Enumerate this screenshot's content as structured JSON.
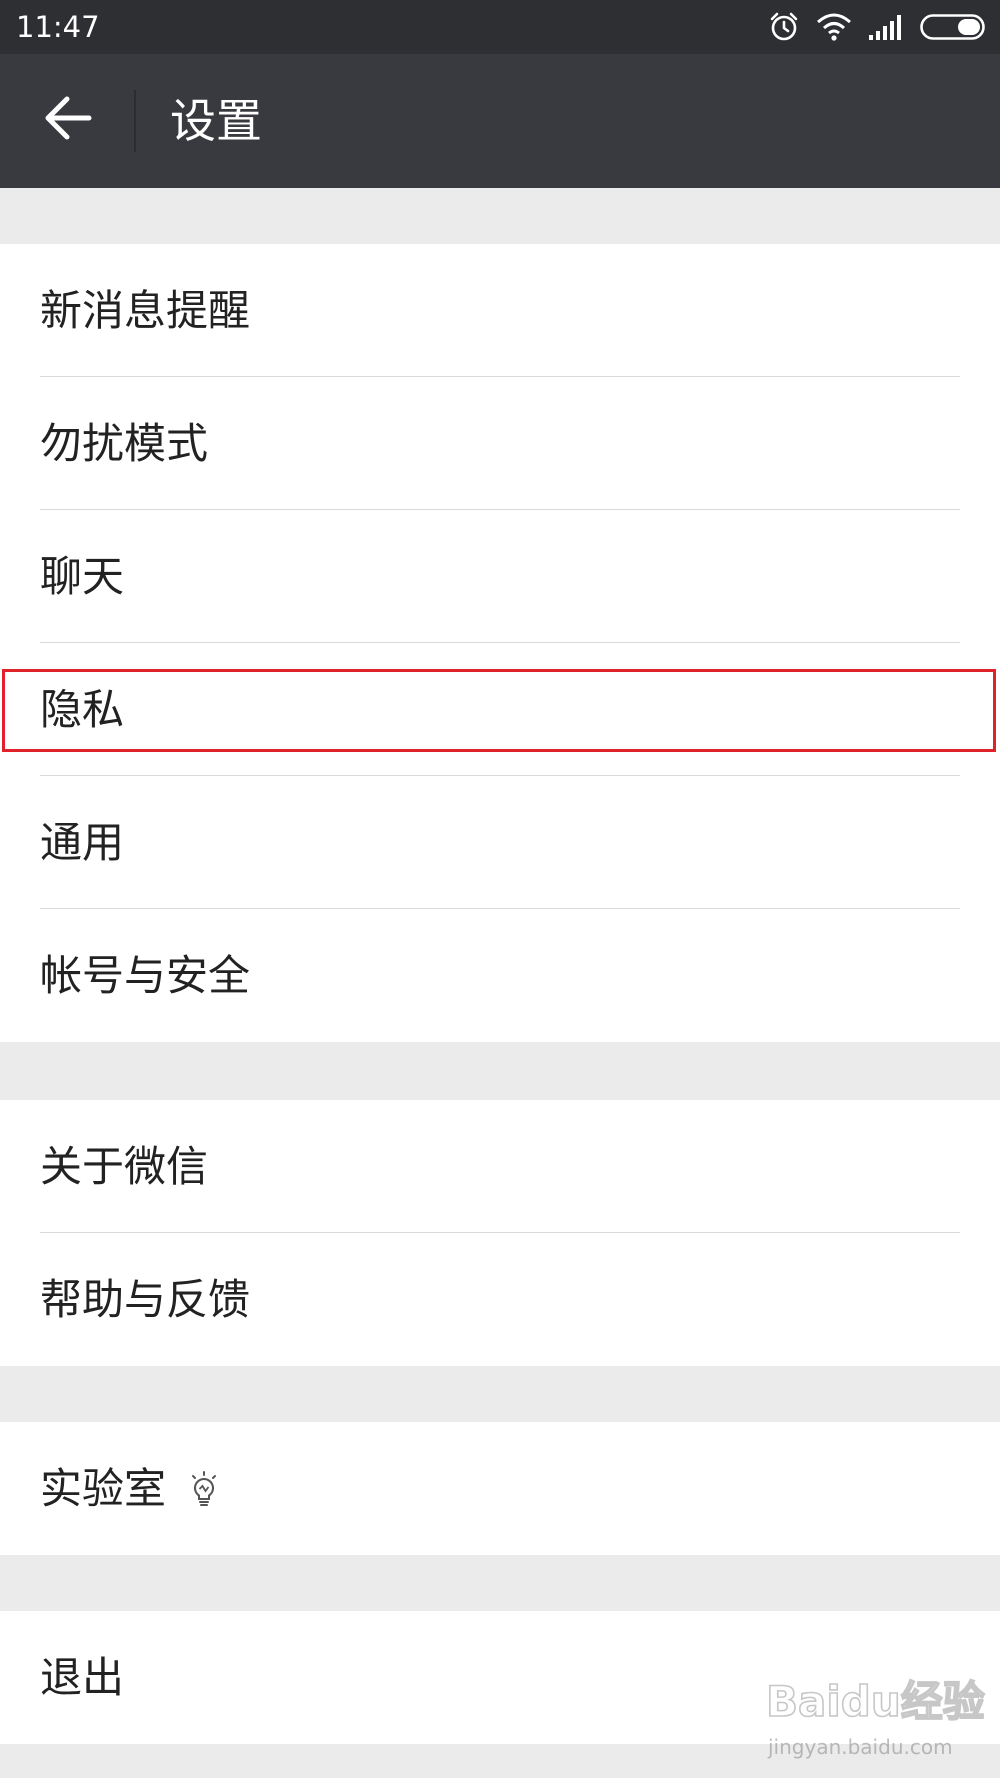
{
  "status_bar": {
    "time": "11:47",
    "icons": [
      "alarm-icon",
      "wifi-icon",
      "signal-icon",
      "battery-icon"
    ]
  },
  "header": {
    "back_icon": "arrow-left-icon",
    "title": "设置",
    "background": "#393a3f"
  },
  "groups": [
    {
      "items": [
        {
          "label": "新消息提醒"
        },
        {
          "label": "勿扰模式"
        },
        {
          "label": "聊天"
        },
        {
          "label": "隐私",
          "highlighted": true
        },
        {
          "label": "通用"
        },
        {
          "label": "帐号与安全"
        }
      ]
    },
    {
      "items": [
        {
          "label": "关于微信"
        },
        {
          "label": "帮助与反馈"
        }
      ]
    },
    {
      "items": [
        {
          "label": "实验室",
          "icon": "lightbulb-icon"
        }
      ]
    },
    {
      "items": [
        {
          "label": "退出"
        }
      ]
    }
  ],
  "highlight_color": "#e0232b",
  "watermark": {
    "brand_text": "Baidu经验",
    "url_text": "jingyan.baidu.com"
  }
}
